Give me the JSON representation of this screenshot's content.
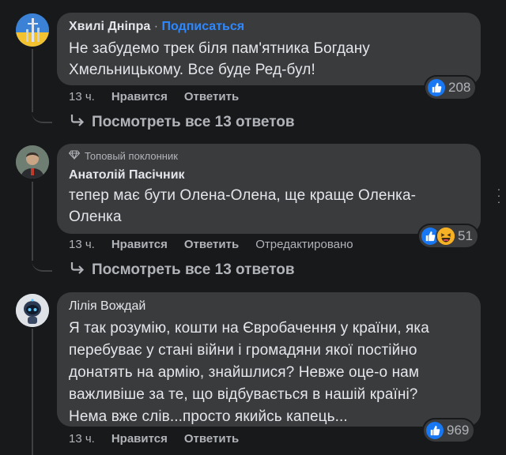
{
  "comments": [
    {
      "author": "Хвилі Дніпра",
      "separator": "·",
      "subscribe": "Подписаться",
      "text_lines": [
        "Не забудемо трек біля пам'ятника Богдану",
        "Хмельницькому. Все буде Ред-бул!"
      ],
      "time": "13 ч.",
      "like_label": "Нравится",
      "reply_label": "Ответить",
      "reaction_count": "208",
      "replies_label": "Посмотреть все 13 ответов"
    },
    {
      "badge": "Топовый поклонник",
      "author": "Анатолій Пасічник",
      "text_lines": [
        "тепер має бути Олена-Олена, ще краще Оленка-",
        "Оленка"
      ],
      "time": "13 ч.",
      "like_label": "Нравится",
      "reply_label": "Ответить",
      "edited_label": "Отредактировано",
      "reaction_count": "51",
      "replies_label": "Посмотреть все 13 ответов"
    },
    {
      "author": "Лілія Вождай",
      "text_lines": [
        "Я так розумію, кошти на Євробачення у країни, яка",
        "перебуває у стані війни і громадяни якої постійно",
        "донатять на армію, знайшлися? Невже оце-о нам",
        "важливіше за те, що відбувається в нашій країні?",
        "Нема вже слів...просто якийсь капець..."
      ],
      "time": "13 ч.",
      "like_label": "Нравится",
      "reply_label": "Ответить",
      "reaction_count": "969"
    }
  ],
  "colors": {
    "background": "#18191a",
    "bubble": "#3a3b3c",
    "link": "#2d88ff",
    "like": "#1877f2"
  },
  "icons": [
    "like-icon",
    "haha-icon",
    "reply-arrow-icon",
    "diamond-badge-icon",
    "more-options-icon"
  ]
}
